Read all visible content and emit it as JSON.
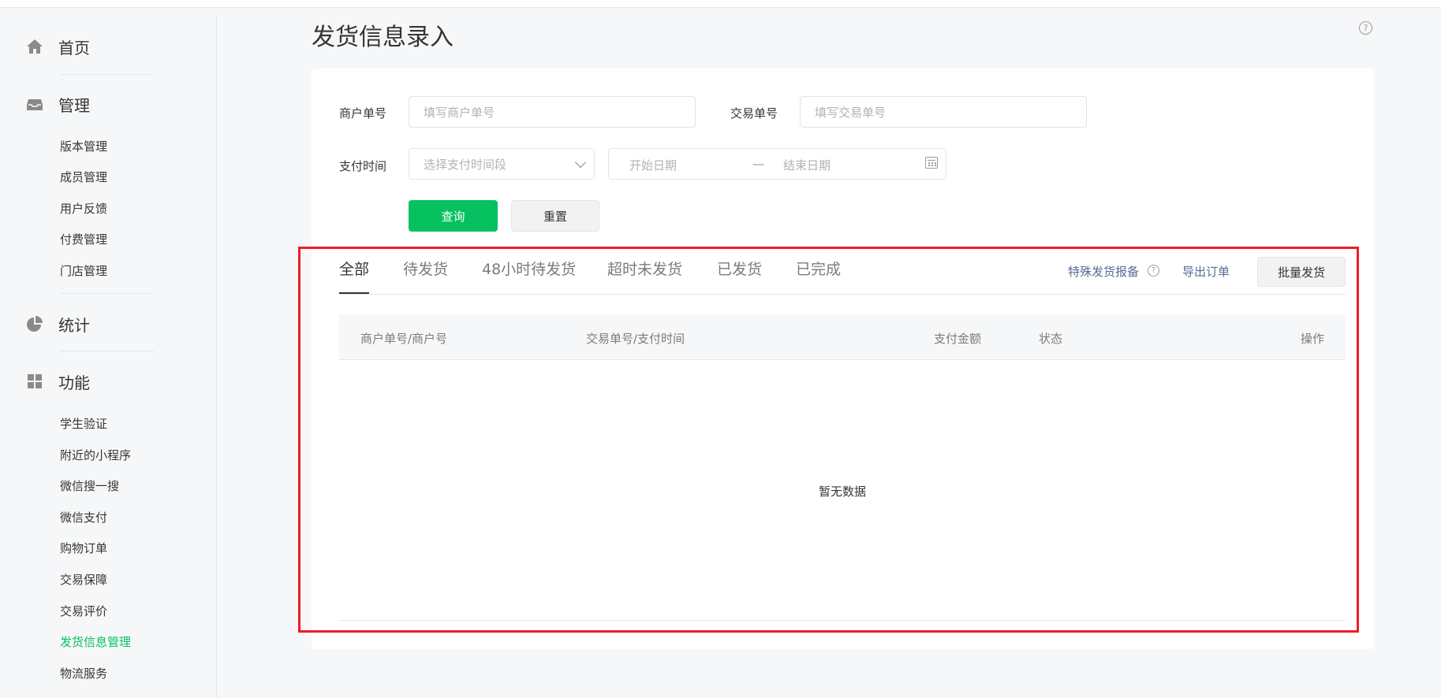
{
  "sidebar": {
    "sections": [
      {
        "label": "首页",
        "icon": "home-icon"
      },
      {
        "label": "管理",
        "icon": "inbox-icon",
        "items": [
          "版本管理",
          "成员管理",
          "用户反馈",
          "付费管理",
          "门店管理"
        ]
      },
      {
        "label": "统计",
        "icon": "pie-chart-icon"
      },
      {
        "label": "功能",
        "icon": "grid-icon",
        "items": [
          "学生验证",
          "附近的小程序",
          "微信搜一搜",
          "微信支付",
          "购物订单",
          "交易保障",
          "交易评价",
          "发货信息管理",
          "物流服务"
        ]
      }
    ],
    "active_item": "发货信息管理"
  },
  "page": {
    "title": "发货信息录入",
    "help_icon": "?"
  },
  "filters": {
    "merchant_no_label": "商户单号",
    "merchant_no_placeholder": "填写商户单号",
    "trade_no_label": "交易单号",
    "trade_no_placeholder": "填写交易单号",
    "pay_time_label": "支付时间",
    "pay_time_select_placeholder": "选择支付时间段",
    "start_date_placeholder": "开始日期",
    "range_separator": "—",
    "end_date_placeholder": "结束日期",
    "query_button": "查询",
    "reset_button": "重置"
  },
  "tabs": [
    "全部",
    "待发货",
    "48小时待发货",
    "超时未发货",
    "已发货",
    "已完成"
  ],
  "active_tab": "全部",
  "actions": {
    "special_report": "特殊发货报备",
    "help_icon": "?",
    "export_orders": "导出订单",
    "batch_ship": "批量发货"
  },
  "table": {
    "columns": [
      "商户单号/商户号",
      "交易单号/支付时间",
      "支付金额",
      "状态",
      "操作"
    ],
    "empty_text": "暂无数据"
  },
  "colors": {
    "accent": "#07c160",
    "link": "#576b95",
    "highlight_box": "#ee1c24"
  }
}
